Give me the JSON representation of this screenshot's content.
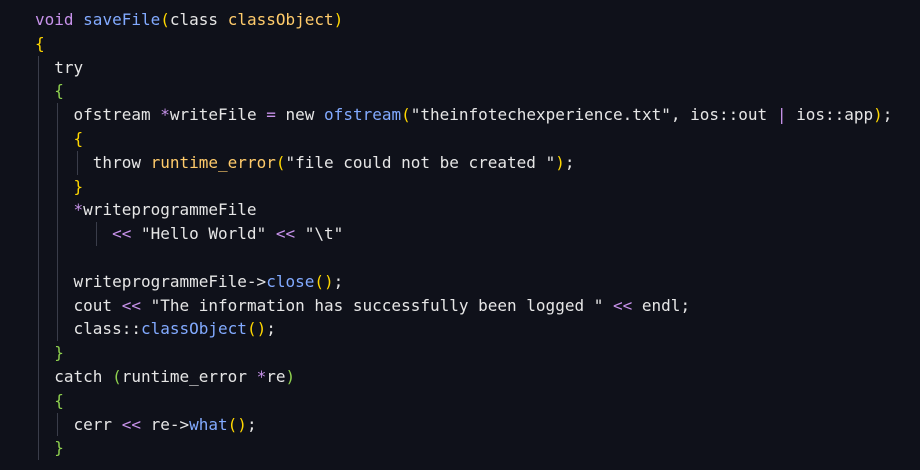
{
  "colors": {
    "background": "#0f111a",
    "text": "#e6e6e6",
    "keyword": "#c792ea",
    "function": "#82aaff",
    "class": "#ffcb6b",
    "bracket_yellow": "#ffd700",
    "bracket_magenta": "#da70d6",
    "bracket_blue": "#179fff",
    "bracket_green": "#8fd14f",
    "indent_guide": "#3a3d4a"
  },
  "editor": {
    "lines": [
      {
        "indent": 0,
        "guides": [],
        "tokens": [
          {
            "t": "void",
            "c": "kw"
          },
          {
            "t": " ",
            "c": "plain"
          },
          {
            "t": "saveFile",
            "c": "fn"
          },
          {
            "t": "(",
            "c": "br-y"
          },
          {
            "t": "class",
            "c": "plain"
          },
          {
            "t": " ",
            "c": "plain"
          },
          {
            "t": "classObject",
            "c": "cls"
          },
          {
            "t": ")",
            "c": "br-y"
          }
        ]
      },
      {
        "indent": 0,
        "guides": [],
        "tokens": [
          {
            "t": "{",
            "c": "br-y"
          }
        ]
      },
      {
        "indent": 2,
        "guides": [
          0
        ],
        "tokens": [
          {
            "t": "try",
            "c": "plain"
          }
        ]
      },
      {
        "indent": 2,
        "guides": [
          0
        ],
        "tokens": [
          {
            "t": "{",
            "c": "br-g"
          }
        ]
      },
      {
        "indent": 4,
        "guides": [
          0,
          2
        ],
        "tokens": [
          {
            "t": "ofstream",
            "c": "plain"
          },
          {
            "t": " ",
            "c": "plain"
          },
          {
            "t": "*",
            "c": "op"
          },
          {
            "t": "writeFile",
            "c": "plain"
          },
          {
            "t": " ",
            "c": "plain"
          },
          {
            "t": "=",
            "c": "op"
          },
          {
            "t": " ",
            "c": "plain"
          },
          {
            "t": "new",
            "c": "plain"
          },
          {
            "t": " ",
            "c": "plain"
          },
          {
            "t": "ofstream",
            "c": "fn"
          },
          {
            "t": "(",
            "c": "br-y"
          },
          {
            "t": "\"theinfotechexperience.txt\"",
            "c": "strw"
          },
          {
            "t": ", ",
            "c": "plain"
          },
          {
            "t": "ios::out",
            "c": "plain"
          },
          {
            "t": " ",
            "c": "plain"
          },
          {
            "t": "|",
            "c": "op"
          },
          {
            "t": " ",
            "c": "plain"
          },
          {
            "t": "ios::app",
            "c": "plain"
          },
          {
            "t": ")",
            "c": "br-y"
          },
          {
            "t": ";",
            "c": "plain"
          }
        ]
      },
      {
        "indent": 4,
        "guides": [
          0,
          2
        ],
        "tokens": [
          {
            "t": "{",
            "c": "br-y"
          }
        ]
      },
      {
        "indent": 6,
        "guides": [
          0,
          2,
          4
        ],
        "tokens": [
          {
            "t": "throw",
            "c": "plain"
          },
          {
            "t": " ",
            "c": "plain"
          },
          {
            "t": "runtime_error",
            "c": "cls"
          },
          {
            "t": "(",
            "c": "br-y"
          },
          {
            "t": "\"file could not be created \"",
            "c": "strw"
          },
          {
            "t": ")",
            "c": "br-y"
          },
          {
            "t": ";",
            "c": "plain"
          }
        ]
      },
      {
        "indent": 4,
        "guides": [
          0,
          2
        ],
        "tokens": [
          {
            "t": "}",
            "c": "br-y"
          }
        ]
      },
      {
        "indent": 4,
        "guides": [
          0,
          2
        ],
        "tokens": [
          {
            "t": "*",
            "c": "op"
          },
          {
            "t": "writeprogrammeFile",
            "c": "plain"
          }
        ]
      },
      {
        "indent": 8,
        "guides": [
          0,
          2,
          6
        ],
        "tokens": [
          {
            "t": "<<",
            "c": "op"
          },
          {
            "t": " ",
            "c": "plain"
          },
          {
            "t": "\"Hello World\"",
            "c": "strw"
          },
          {
            "t": " ",
            "c": "plain"
          },
          {
            "t": "<<",
            "c": "op"
          },
          {
            "t": " ",
            "c": "plain"
          },
          {
            "t": "\"\\t\"",
            "c": "strw"
          }
        ]
      },
      {
        "indent": 0,
        "guides": [
          0,
          2
        ],
        "tokens": []
      },
      {
        "indent": 4,
        "guides": [
          0,
          2
        ],
        "tokens": [
          {
            "t": "writeprogrammeFile->",
            "c": "plain"
          },
          {
            "t": "close",
            "c": "fn"
          },
          {
            "t": "()",
            "c": "br-y"
          },
          {
            "t": ";",
            "c": "plain"
          }
        ]
      },
      {
        "indent": 4,
        "guides": [
          0,
          2
        ],
        "tokens": [
          {
            "t": "cout",
            "c": "plain"
          },
          {
            "t": " ",
            "c": "plain"
          },
          {
            "t": "<<",
            "c": "op"
          },
          {
            "t": " ",
            "c": "plain"
          },
          {
            "t": "\"The information has successfully been logged \"",
            "c": "strw"
          },
          {
            "t": " ",
            "c": "plain"
          },
          {
            "t": "<<",
            "c": "op"
          },
          {
            "t": " ",
            "c": "plain"
          },
          {
            "t": "endl",
            "c": "plain"
          },
          {
            "t": ";",
            "c": "plain"
          }
        ]
      },
      {
        "indent": 4,
        "guides": [
          0,
          2
        ],
        "tokens": [
          {
            "t": "class::",
            "c": "plain"
          },
          {
            "t": "classObject",
            "c": "fn"
          },
          {
            "t": "()",
            "c": "br-y"
          },
          {
            "t": ";",
            "c": "plain"
          }
        ]
      },
      {
        "indent": 2,
        "guides": [
          0
        ],
        "tokens": [
          {
            "t": "}",
            "c": "br-g"
          }
        ]
      },
      {
        "indent": 2,
        "guides": [
          0
        ],
        "tokens": [
          {
            "t": "catch",
            "c": "plain"
          },
          {
            "t": " ",
            "c": "plain"
          },
          {
            "t": "(",
            "c": "br-g"
          },
          {
            "t": "runtime_error",
            "c": "plain"
          },
          {
            "t": " ",
            "c": "plain"
          },
          {
            "t": "*",
            "c": "op"
          },
          {
            "t": "re",
            "c": "plain"
          },
          {
            "t": ")",
            "c": "br-g"
          }
        ]
      },
      {
        "indent": 2,
        "guides": [
          0
        ],
        "tokens": [
          {
            "t": "{",
            "c": "br-g"
          }
        ]
      },
      {
        "indent": 4,
        "guides": [
          0,
          2
        ],
        "tokens": [
          {
            "t": "cerr",
            "c": "plain"
          },
          {
            "t": " ",
            "c": "plain"
          },
          {
            "t": "<<",
            "c": "op"
          },
          {
            "t": " ",
            "c": "plain"
          },
          {
            "t": "re->",
            "c": "plain"
          },
          {
            "t": "what",
            "c": "fn"
          },
          {
            "t": "()",
            "c": "br-y"
          },
          {
            "t": ";",
            "c": "plain"
          }
        ]
      },
      {
        "indent": 2,
        "guides": [
          0
        ],
        "tokens": [
          {
            "t": "}",
            "c": "br-g"
          }
        ]
      }
    ]
  }
}
